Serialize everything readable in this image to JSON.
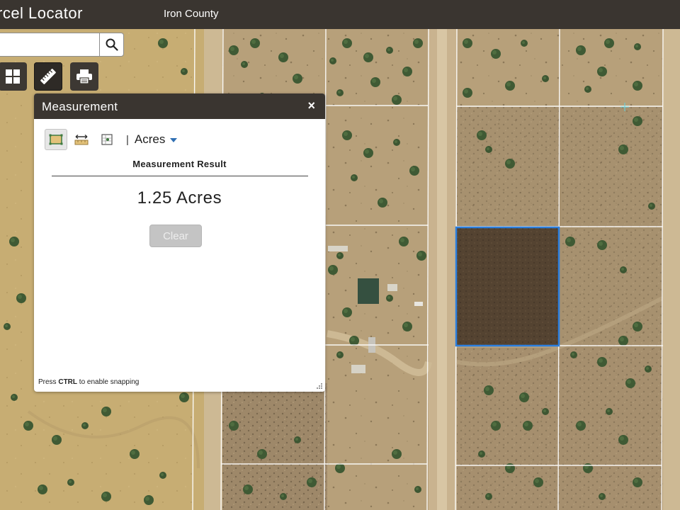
{
  "header": {
    "app_title": "rcel Locator",
    "county": "Iron County"
  },
  "search": {
    "value": "",
    "placeholder": ""
  },
  "icons": {
    "search": "search-icon",
    "basemap": "grid-icon",
    "measure": "ruler-icon",
    "print": "printer-icon"
  },
  "measurement_panel": {
    "title": "Measurement",
    "close_glyph": "×",
    "modes": [
      "area",
      "distance",
      "location"
    ],
    "active_mode": "area",
    "separator": "|",
    "unit": "Acres",
    "result_label": "Measurement Result",
    "result_value": "1.25 Acres",
    "clear_label": "Clear",
    "hint_prefix": "Press ",
    "hint_key": "CTRL",
    "hint_suffix": " to enable snapping"
  },
  "colors": {
    "header_bg": "#3a3530",
    "measured_polygon_stroke": "#2b7fe0",
    "measured_polygon_fill": "#4a3a2a",
    "parcel_line": "#ffffff",
    "unit_caret": "#2f6fb3"
  }
}
